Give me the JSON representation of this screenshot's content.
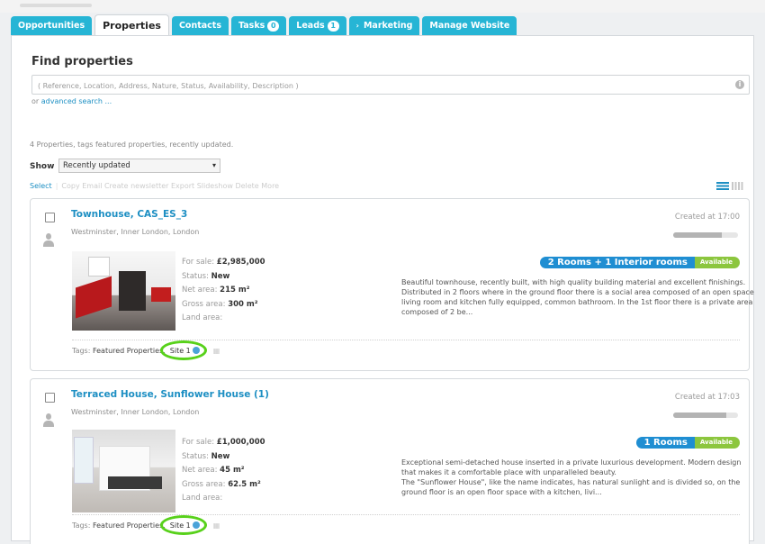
{
  "tabs": [
    {
      "label": "Opportunities"
    },
    {
      "label": "Properties",
      "active": true
    },
    {
      "label": "Contacts"
    },
    {
      "label": "Tasks",
      "badge": "0"
    },
    {
      "label": "Leads",
      "badge": "1"
    },
    {
      "label": "Marketing",
      "arrow": "›"
    },
    {
      "label": "Manage Website"
    }
  ],
  "search": {
    "title": "Find properties",
    "placeholder": "( Reference, Location, Address, Nature, Status, Availability, Description )",
    "advanced_prefix": "or",
    "advanced_link": "advanced search ..."
  },
  "summary": "4 Properties, tags featured properties, recently updated.",
  "show": {
    "label": "Show",
    "selected": "Recently updated"
  },
  "actions": {
    "select": "Select",
    "list": "Copy Email Create newsletter Export Slideshow Delete More"
  },
  "colors": {
    "tab": "#26b5d5",
    "link": "#1d8fc3",
    "rooms": "#1f8ed2",
    "available": "#8cc63e",
    "highlight": "#58d11b"
  },
  "properties": [
    {
      "title": "Townhouse, CAS_ES_3",
      "location": "Westminster, Inner London, London",
      "created": "Created at 17:00",
      "progress": 0.75,
      "price_label": "For sale:",
      "price": "£2,985,000",
      "status_label": "Status:",
      "status": "New",
      "net_label": "Net area:",
      "net": "215 m²",
      "gross_label": "Gross area:",
      "gross": "300 m²",
      "land_label": "Land area:",
      "rooms": "2 Rooms + 1 Interior rooms",
      "availability": "Available",
      "description": "Beautiful townhouse, recently built, with high quality building material and excellent finishings.\nDistributed in 2 floors where in the ground floor there is a social area composed of an open space living room and kitchen fully equipped, common bathroom. In the 1st floor there is a private area composed of 2 be...",
      "tags_label": "Tags:",
      "tag1": "Featured Properties,",
      "tag2": "Site 1"
    },
    {
      "title": "Terraced House, Sunflower House (1)",
      "location": "Westminster, Inner London, London",
      "created": "Created at 17:03",
      "progress": 0.82,
      "price_label": "For sale:",
      "price": "£1,000,000",
      "status_label": "Status:",
      "status": "New",
      "net_label": "Net area:",
      "net": "45 m²",
      "gross_label": "Gross area:",
      "gross": "62.5 m²",
      "land_label": "Land area:",
      "rooms": "1 Rooms",
      "availability": "Available",
      "description": "Exceptional semi-detached house inserted in a private luxurious development. Modern design that makes it a comfortable place with unparalleled beauty.\nThe \"Sunflower House\", like the name indicates, has natural sunlight and is divided so, on the ground floor is an open floor space with a kitchen, livi...",
      "tags_label": "Tags:",
      "tag1": "Featured Properties,",
      "tag2": "Site 1"
    }
  ]
}
